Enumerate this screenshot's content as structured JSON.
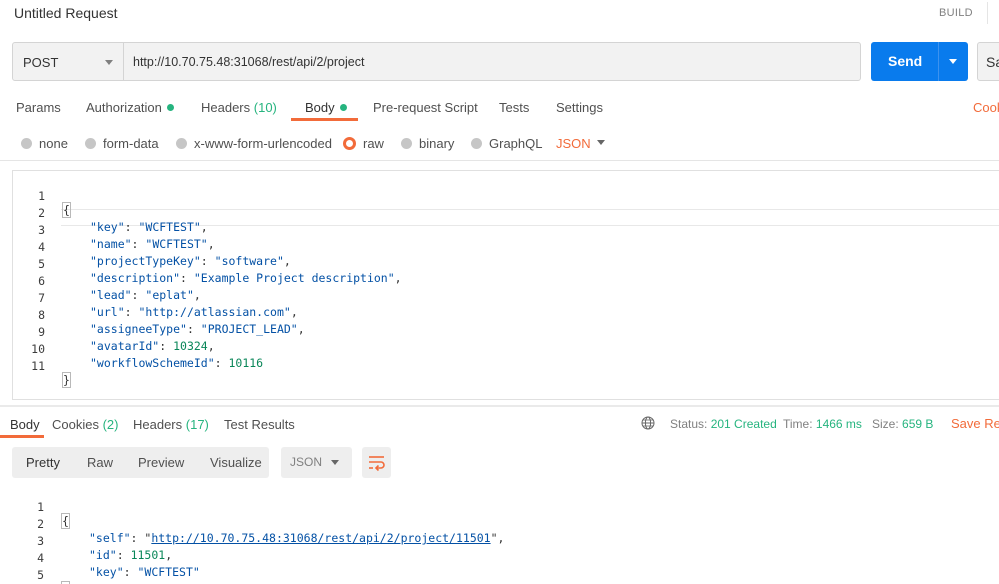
{
  "title_bar": {
    "title": "Untitled Request",
    "build_label": "BUILD"
  },
  "request": {
    "method": "POST",
    "url": "http://10.70.75.48:31068/rest/api/2/project",
    "send_label": "Send",
    "save_label": "Sa"
  },
  "request_tabs": [
    {
      "label": "Params",
      "count": "",
      "dot": false
    },
    {
      "label": "Authorization",
      "count": "",
      "dot": true
    },
    {
      "label": "Headers",
      "count": "(10)",
      "dot": false
    },
    {
      "label": "Body",
      "count": "",
      "dot": true,
      "active": true
    },
    {
      "label": "Pre-request Script",
      "count": "",
      "dot": false
    },
    {
      "label": "Tests",
      "count": "",
      "dot": false
    },
    {
      "label": "Settings",
      "count": "",
      "dot": false
    }
  ],
  "cookies_link": "Cook",
  "body_types": [
    {
      "label": "none",
      "selected": false
    },
    {
      "label": "form-data",
      "selected": false
    },
    {
      "label": "x-www-form-urlencoded",
      "selected": false
    },
    {
      "label": "raw",
      "selected": true
    },
    {
      "label": "binary",
      "selected": false
    },
    {
      "label": "GraphQL",
      "selected": false
    }
  ],
  "raw_format": "JSON",
  "request_body": {
    "open": "{",
    "close": "}",
    "fields": [
      {
        "key": "\"key\"",
        "value": "\"WCFTEST\"",
        "value_type": "string",
        "trail": ","
      },
      {
        "key": "\"name\"",
        "value": "\"WCFTEST\"",
        "value_type": "string",
        "trail": ","
      },
      {
        "key": "\"projectTypeKey\"",
        "value": "\"software\"",
        "value_type": "string",
        "trail": ","
      },
      {
        "key": "\"description\"",
        "value": "\"Example Project description\"",
        "value_type": "string",
        "trail": ","
      },
      {
        "key": "\"lead\"",
        "value": "\"eplat\"",
        "value_type": "string",
        "trail": ","
      },
      {
        "key": "\"url\"",
        "value": "\"http://atlassian.com\"",
        "value_type": "string",
        "trail": ","
      },
      {
        "key": "\"assigneeType\"",
        "value": "\"PROJECT_LEAD\"",
        "value_type": "string",
        "trail": ","
      },
      {
        "key": "\"avatarId\"",
        "value": "10324",
        "value_type": "number",
        "trail": ","
      },
      {
        "key": "\"workflowSchemeId\"",
        "value": "10116",
        "value_type": "number",
        "trail": ""
      }
    ],
    "line_numbers": [
      "1",
      "2",
      "3",
      "4",
      "5",
      "6",
      "7",
      "8",
      "9",
      "10",
      "11"
    ]
  },
  "response_tabs": [
    {
      "label": "Body",
      "count": "",
      "active": true
    },
    {
      "label": "Cookies",
      "count": "(2)"
    },
    {
      "label": "Headers",
      "count": "(17)"
    },
    {
      "label": "Test Results",
      "count": ""
    }
  ],
  "response_meta": {
    "status_label": "Status:",
    "status_value": "201 Created",
    "time_label": "Time:",
    "time_value": "1466 ms",
    "size_label": "Size:",
    "size_value": "659 B",
    "save_response": "Save Res"
  },
  "view_modes": [
    "Pretty",
    "Raw",
    "Preview",
    "Visualize"
  ],
  "response_format": "JSON",
  "response_body": {
    "open": "{",
    "close": "}",
    "fields": [
      {
        "key": "\"self\"",
        "value": "http://10.70.75.48:31068/rest/api/2/project/11501",
        "value_type": "link",
        "trail": ","
      },
      {
        "key": "\"id\"",
        "value": "11501",
        "value_type": "number",
        "trail": ","
      },
      {
        "key": "\"key\"",
        "value": "\"WCFTEST\"",
        "value_type": "string",
        "trail": ""
      }
    ],
    "line_numbers": [
      "1",
      "2",
      "3",
      "4",
      "5"
    ]
  },
  "colors": {
    "accent": "#f26b3a",
    "send": "#097bed",
    "status_ok": "#26b47f"
  }
}
